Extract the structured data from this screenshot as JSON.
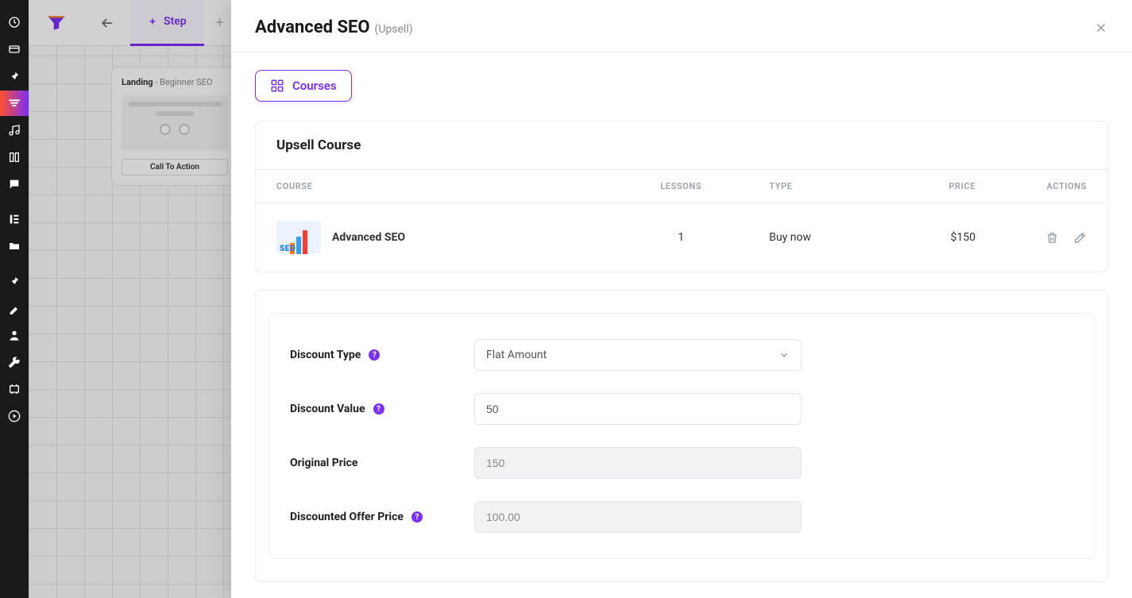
{
  "topbar": {
    "step_tab": "Step",
    "card": {
      "title": "Landing",
      "subtitle": " - Beginner SEO",
      "cta": "Call To Action"
    }
  },
  "panel": {
    "title": "Advanced SEO",
    "suffix": "(Upsell)",
    "courses_btn": "Courses",
    "section_title": "Upsell Course",
    "headers": {
      "course": "Course",
      "lessons": "Lessons",
      "type": "Type",
      "price": "Price",
      "actions": "Actions"
    },
    "row": {
      "name": "Advanced SEO",
      "lessons": "1",
      "type": "Buy now",
      "price": "$150",
      "thumb_text": "SEO"
    },
    "form": {
      "discount_type": {
        "label": "Discount Type",
        "value": "Flat Amount"
      },
      "discount_value": {
        "label": "Discount Value",
        "value": "50"
      },
      "original_price": {
        "label": "Original Price",
        "value": "150"
      },
      "discounted_price": {
        "label": "Discounted Offer Price",
        "value": "100.00"
      }
    }
  }
}
